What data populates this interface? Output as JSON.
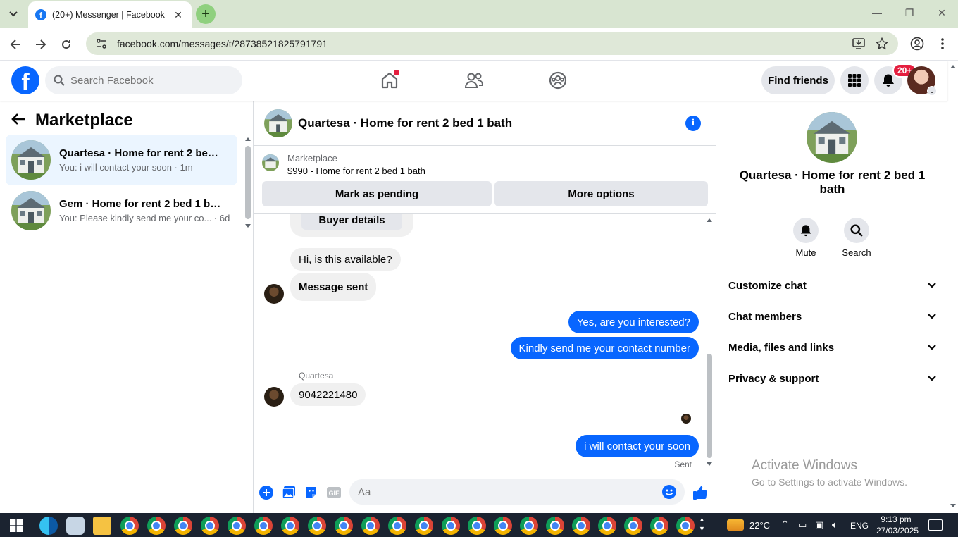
{
  "browser": {
    "tab_title": "(20+) Messenger | Facebook",
    "url": "facebook.com/messages/t/28738521825791791"
  },
  "fb": {
    "search_placeholder": "Search Facebook",
    "find_friends": "Find friends",
    "notif_badge": "20+",
    "logo_letter": "f"
  },
  "left": {
    "title": "Marketplace",
    "conversations": [
      {
        "name": "Quartesa · Home for rent 2 bed 1 bath",
        "snippet": "You: i will contact your soon · 1m"
      },
      {
        "name": "Gem · Home for rent 2 bed 1 bath",
        "snippet": "You: Please kindly send me your co... · 6d"
      }
    ]
  },
  "chat": {
    "title": "Quartesa · Home for rent 2 bed 1 bath",
    "marketplace_label": "Marketplace",
    "listing": "$990 - Home for rent 2 bed 1 bath",
    "mark_pending": "Mark as pending",
    "more_options": "More options",
    "buyer_details": "Buyer details",
    "messages": {
      "m1": "Hi, is this available?",
      "m2": "Message sent",
      "m3": "Yes, are you interested?",
      "m4": "Kindly send me your contact number",
      "sender_label": "Quartesa",
      "m5": "9042221480",
      "m6": "i will contact your soon",
      "status": "Sent"
    },
    "composer_placeholder": "Aa"
  },
  "right": {
    "title": "Quartesa · Home for rent 2 bed 1 bath",
    "mute": "Mute",
    "search": "Search",
    "sections": [
      "Customize chat",
      "Chat members",
      "Media, files and links",
      "Privacy & support"
    ]
  },
  "watermark": {
    "line1": "Activate Windows",
    "line2": "Go to Settings to activate Windows."
  },
  "taskbar": {
    "temp": "22°C",
    "lang": "ENG",
    "time": "9:13 pm",
    "date": "27/03/2025"
  },
  "colors": {
    "fb_blue": "#0866ff",
    "chrome_frame": "#d8e5d1",
    "outgoing_bubble": "#0866ff",
    "badge_red": "#e41e3f"
  }
}
